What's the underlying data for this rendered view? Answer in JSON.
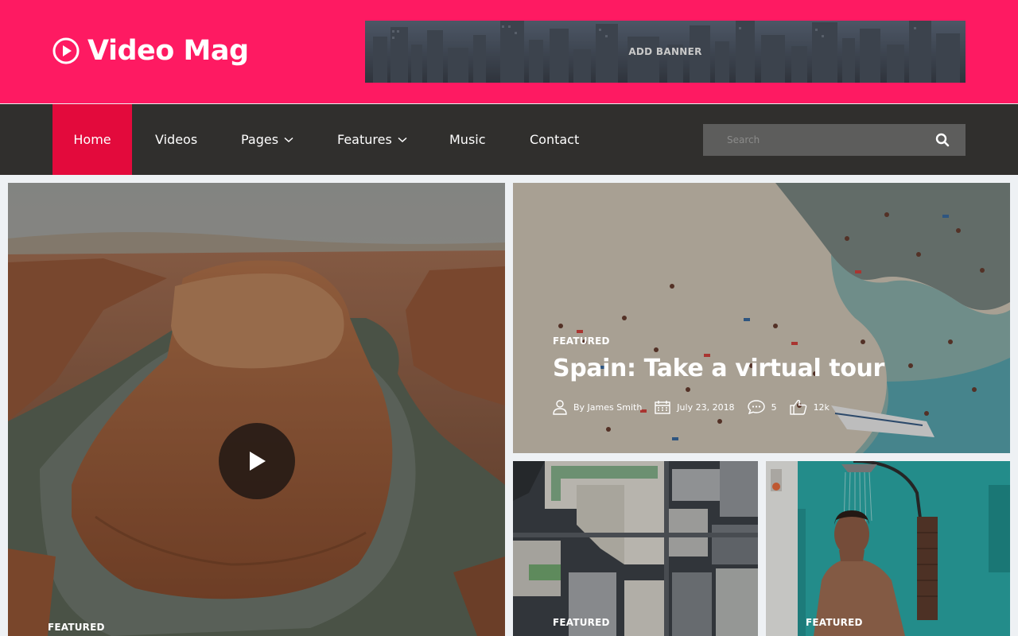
{
  "header": {
    "logo_text": "Video Mag",
    "banner_text": "ADD BANNER",
    "brand_color": "#fe1a62"
  },
  "nav": {
    "items": [
      {
        "label": "Home",
        "active": true
      },
      {
        "label": "Videos"
      },
      {
        "label": "Pages",
        "dropdown": true
      },
      {
        "label": "Features",
        "dropdown": true
      },
      {
        "label": "Music"
      },
      {
        "label": "Contact"
      }
    ],
    "search_placeholder": "Search",
    "active_color": "#e30a3c"
  },
  "posts": {
    "main": {
      "badge": "FEATURED"
    },
    "spain": {
      "badge": "FEATURED",
      "title": "Spain: Take a virtual tour",
      "author": "By James Smith",
      "date": "July 23, 2018",
      "comments": "5",
      "likes": "12k"
    },
    "city": {
      "badge": "FEATURED"
    },
    "shower": {
      "badge": "FEATURED"
    }
  },
  "icons": [
    "play-circle-icon",
    "search-icon",
    "chevron-down-icon",
    "play-icon",
    "user-icon",
    "calendar-icon",
    "comment-icon",
    "thumbs-up-icon"
  ]
}
